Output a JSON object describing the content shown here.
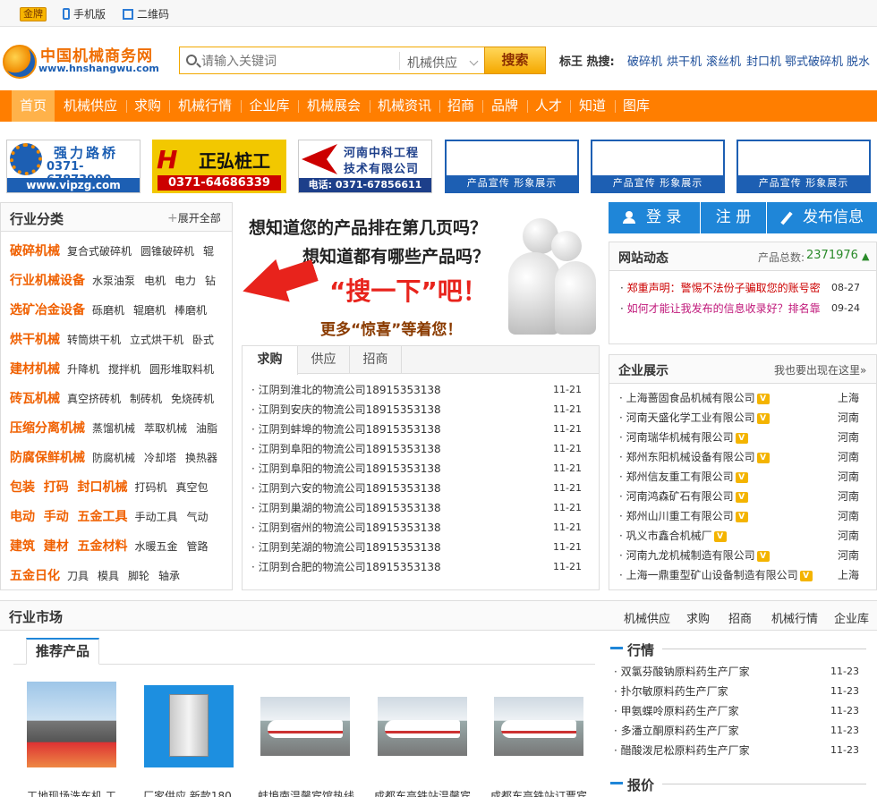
{
  "topbar": {
    "gold_badge": "金牌",
    "mobile_label": "手机版",
    "qr_label": "二维码"
  },
  "logo": {
    "title": "中国机械商务网",
    "url": "www.hnshangwu.com"
  },
  "search": {
    "placeholder": "请输入关键词",
    "category": "机械供应",
    "button": "搜索"
  },
  "hot": {
    "label": "标王  热搜:",
    "terms": [
      "破碎机",
      "烘干机",
      "滚丝机",
      "封口机",
      "鄂式破碎机",
      "脱水"
    ]
  },
  "nav": [
    "首页",
    "机械供应",
    "求购",
    "机械行情",
    "企业库",
    "机械展会",
    "机械资讯",
    "招商",
    "品牌",
    "人才",
    "知道",
    "图库"
  ],
  "ads": {
    "ad1": {
      "name": "强力路桥",
      "phone": "0371-67873999",
      "url": "www.vipzg.com"
    },
    "ad2": {
      "name": "正弘桩工",
      "phone": "0371-64686339",
      "mark": "H"
    },
    "ad3": {
      "name1": "河南中科工程",
      "name2": "技术有限公司",
      "phone": "电话: 0371-67856611"
    },
    "empty_caption": "产品宣传 形象展示"
  },
  "categories": {
    "title": "行业分类",
    "expand": "展开全部",
    "rows": [
      {
        "main": "破碎机械",
        "subs": [
          "复合式破碎机",
          "圆锥破碎机",
          "辊"
        ]
      },
      {
        "main": "行业机械设备",
        "subs": [
          "水泵油泵",
          "电机",
          "电力",
          "钻"
        ]
      },
      {
        "main": "选矿冶金设备",
        "subs": [
          "砾磨机",
          "辊磨机",
          "棒磨机"
        ]
      },
      {
        "main": "烘干机械",
        "subs": [
          "转筒烘干机",
          "立式烘干机",
          "卧式"
        ]
      },
      {
        "main": "建材机械",
        "subs": [
          "升降机",
          "搅拌机",
          "圆形堆取料机"
        ]
      },
      {
        "main": "砖瓦机械",
        "subs": [
          "真空挤砖机",
          "制砖机",
          "免烧砖机"
        ]
      },
      {
        "main": "压缩分离机械",
        "subs": [
          "蒸馏机械",
          "萃取机械",
          "油脂"
        ]
      },
      {
        "main": "防腐保鲜机械",
        "subs": [
          "防腐机械",
          "冷却塔",
          "换热器"
        ]
      },
      {
        "main": "包装  打码  封口机械",
        "subs": [
          "打码机",
          "真空包"
        ]
      },
      {
        "main": "电动  手动  五金工具",
        "subs": [
          "手动工具",
          "气动"
        ]
      },
      {
        "main": "建筑  建材  五金材料",
        "subs": [
          "水暖五金",
          "管路"
        ]
      },
      {
        "main": "五金日化",
        "subs": [
          "刀具",
          "模具",
          "脚轮",
          "轴承"
        ]
      }
    ]
  },
  "promo": {
    "line1": "想知道您的产品排在第几页吗？",
    "line2": "想知道都有哪些产品吗？",
    "line3": "“搜一下”吧！",
    "line4": "更多“惊喜”等着您！"
  },
  "tabs": [
    "求购",
    "供应",
    "招商"
  ],
  "buy_list": [
    {
      "text": "江阴到淮北的物流公司18915353138",
      "date": "11-21"
    },
    {
      "text": "江阴到安庆的物流公司18915353138",
      "date": "11-21"
    },
    {
      "text": "江阴到蚌埠的物流公司18915353138",
      "date": "11-21"
    },
    {
      "text": "江阴到阜阳的物流公司18915353138",
      "date": "11-21"
    },
    {
      "text": "江阴到阜阳的物流公司18915353138",
      "date": "11-21"
    },
    {
      "text": "江阴到六安的物流公司18915353138",
      "date": "11-21"
    },
    {
      "text": "江阴到巢湖的物流公司18915353138",
      "date": "11-21"
    },
    {
      "text": "江阴到宿州的物流公司18915353138",
      "date": "11-21"
    },
    {
      "text": "江阴到芜湖的物流公司18915353138",
      "date": "11-21"
    },
    {
      "text": "江阴到合肥的物流公司18915353138",
      "date": "11-21"
    }
  ],
  "account": {
    "login": "登 录",
    "register": "注 册",
    "publish": "发布信息"
  },
  "news": {
    "title": "网站动态",
    "total_label": "产品总数:",
    "total": "2371976",
    "items": [
      {
        "text": "郑重声明：警惕不法份子骗取您的账号密",
        "date": "08-27"
      },
      {
        "text": "如何才能让我发布的信息收录好？排名靠",
        "date": "09-24"
      }
    ]
  },
  "companies": {
    "title": "企业展示",
    "more": "我也要出现在这里»",
    "items": [
      {
        "name": "上海蔷固食品机械有限公司",
        "region": "上海"
      },
      {
        "name": "河南天盛化学工业有限公司",
        "region": "河南"
      },
      {
        "name": "河南瑞华机械有限公司",
        "region": "河南"
      },
      {
        "name": "郑州东阳机械设备有限公司",
        "region": "河南"
      },
      {
        "name": "郑州信友重工有限公司",
        "region": "河南"
      },
      {
        "name": "河南鸿森矿石有限公司",
        "region": "河南"
      },
      {
        "name": "郑州山川重工有限公司",
        "region": "河南"
      },
      {
        "name": "巩义市鑫合机械厂",
        "region": "河南"
      },
      {
        "name": "河南九龙机械制造有限公司",
        "region": "河南"
      },
      {
        "name": "上海一鼎重型矿山设备制造有限公司",
        "region": "上海"
      }
    ],
    "badge": "V"
  },
  "market": {
    "title": "行业市场",
    "links": [
      "机械供应",
      "求购",
      "招商",
      "机械行情",
      "企业库"
    ],
    "rec_tab": "推荐产品",
    "products": [
      {
        "caption": "工地现场洗车机 工"
      },
      {
        "caption": "厂家供应 新款180"
      },
      {
        "caption": "蚌埠南温馨宾馆热线"
      },
      {
        "caption": "成都东高铁站温馨宾"
      },
      {
        "caption": "成都东高铁站订票宾"
      }
    ],
    "quotes_title": "行情",
    "quotes": [
      {
        "text": "双氯芬酸钠原料药生产厂家",
        "date": "11-23"
      },
      {
        "text": "扑尔敏原料药生产厂家",
        "date": "11-23"
      },
      {
        "text": "甲氨蝶呤原料药生产厂家",
        "date": "11-23"
      },
      {
        "text": "多潘立酮原料药生产厂家",
        "date": "11-23"
      },
      {
        "text": "醋酸泼尼松原料药生产厂家",
        "date": "11-23"
      }
    ],
    "price_title": "报价"
  },
  "colors": {
    "accent": "#ff7e00",
    "brand_blue": "#1f86d8",
    "category": "#f06000"
  }
}
